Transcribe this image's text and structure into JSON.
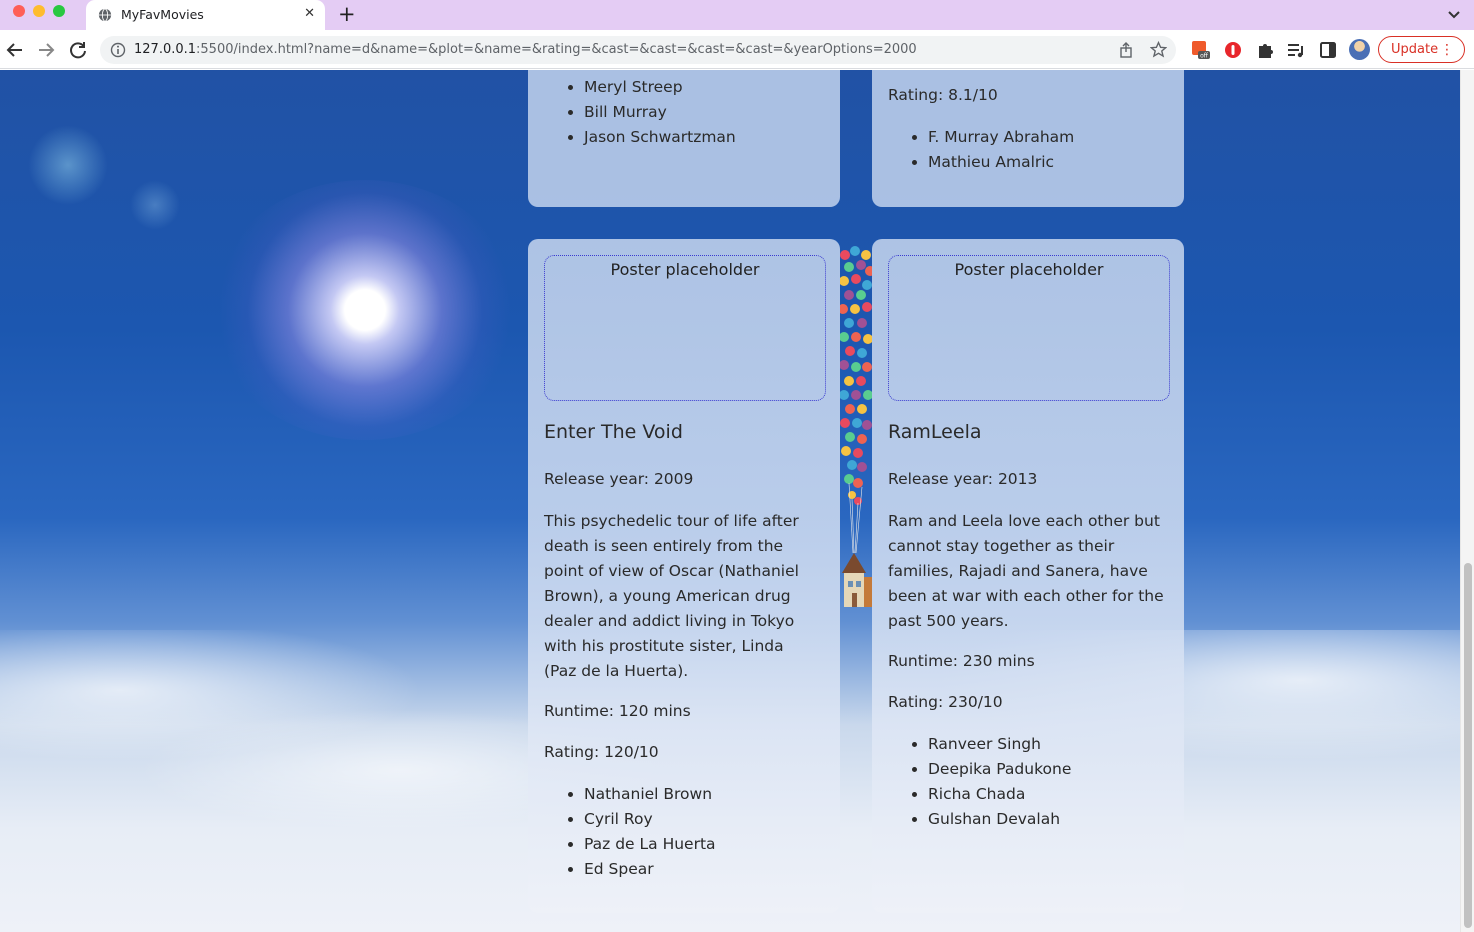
{
  "browser": {
    "tab_title": "MyFavMovies",
    "url_host": "127.0.0.1",
    "url_rest": ":5500/index.html?name=d&name=&plot=&name=&rating=&cast=&cast=&cast=&cast=&yearOptions=2000",
    "update_label": "Update"
  },
  "top_cards": {
    "left": {
      "cast": [
        "Meryl Streep",
        "Bill Murray",
        "Jason Schwartzman"
      ]
    },
    "right": {
      "rating": "Rating: 8.1/10",
      "cast": [
        "F. Murray Abraham",
        "Mathieu Amalric"
      ]
    }
  },
  "movies": [
    {
      "poster": "Poster placeholder",
      "title": "Enter The Void",
      "release": "Release year: 2009",
      "plot": "This psychedelic tour of life after death is seen entirely from the point of view of Oscar (Nathaniel Brown), a young American drug dealer and addict living in Tokyo with his prostitute sister, Linda (Paz de la Huerta).",
      "runtime": "Runtime: 120 mins",
      "rating": "Rating: 120/10",
      "cast": [
        "Nathaniel Brown",
        "Cyril Roy",
        "Paz de La Huerta",
        "Ed Spear"
      ]
    },
    {
      "poster": "Poster placeholder",
      "title": "RamLeela",
      "release": "Release year: 2013",
      "plot": "Ram and Leela love each other but cannot stay together as their families, Rajadi and Sanera, have been at war with each other for the past 500 years.",
      "runtime": "Runtime: 230 mins",
      "rating": "Rating: 230/10",
      "cast": [
        "Ranveer Singh",
        "Deepika Padukone",
        "Richa Chada",
        "Gulshan Devalah"
      ]
    }
  ]
}
